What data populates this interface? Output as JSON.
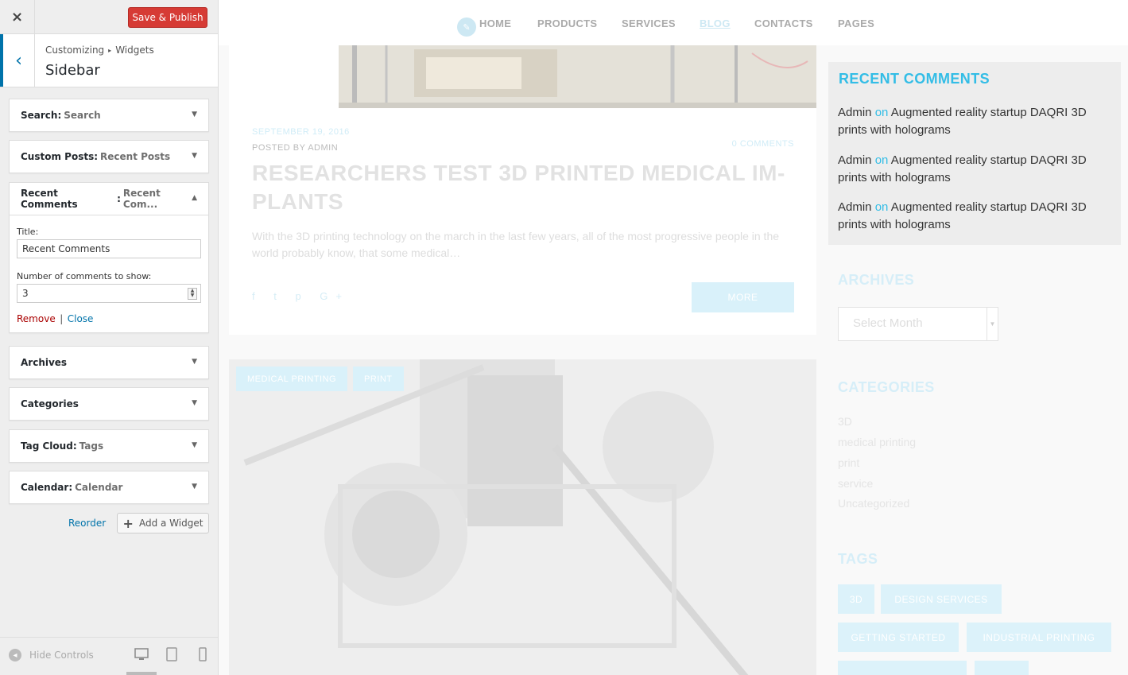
{
  "header": {
    "close_icon": "×",
    "save_label": "Save & Publish"
  },
  "section": {
    "back_icon": "‹",
    "breadcrumb_root": "Customizing",
    "breadcrumb_sep": "▸",
    "breadcrumb_current": "Widgets",
    "title": "Sidebar"
  },
  "widgets": [
    {
      "type": "Search",
      "name": "Search",
      "expanded": false
    },
    {
      "type": "Custom Posts",
      "name": "Recent Posts",
      "expanded": false
    },
    {
      "type": "Recent Comments",
      "name": "Recent Com...",
      "expanded": true
    },
    {
      "type": "Archives",
      "name": "",
      "expanded": false
    },
    {
      "type": "Categories",
      "name": "",
      "expanded": false
    },
    {
      "type": "Tag Cloud",
      "name": "Tags",
      "expanded": false
    },
    {
      "type": "Calendar",
      "name": "Calendar",
      "expanded": false
    }
  ],
  "recent_form": {
    "title_label": "Title:",
    "title_value": "Recent Comments",
    "count_label": "Number of comments to show:",
    "count_value": "3",
    "remove_label": "Remove",
    "separator": "|",
    "close_label": "Close"
  },
  "panel_actions": {
    "reorder_label": "Reorder",
    "add_widget_label": "Add a Widget"
  },
  "footer": {
    "hide_controls_label": "Hide Controls",
    "devices": [
      "desktop",
      "tablet",
      "mobile"
    ]
  },
  "site": {
    "nav": [
      "HOME",
      "PRODUCTS",
      "SERVICES",
      "BLOG",
      "CONTACTS",
      "PAGES"
    ],
    "active_nav": "BLOG",
    "post": {
      "date": "SEPTEMBER 19, 2016",
      "byline": "POSTED BY ADMIN",
      "comments": "0 COMMENTS",
      "title": "RESEARCHERS TEST 3D PRINTED MEDICAL IM-PLANTS",
      "excerpt": "With the 3D printing technology on the march in the last few years, all of the most progressive people in the world probably know, that some medical…",
      "social": "f t p G+",
      "more_label": "MORE"
    },
    "post2_tags": [
      "MEDICAL PRINTING",
      "PRINT"
    ],
    "recent_comments": {
      "title": "RECENT COMMENTS",
      "items": [
        {
          "author": "Admin",
          "on": "on",
          "post": "Augmented reality startup DAQRI 3D prints with holograms"
        },
        {
          "author": "Admin",
          "on": "on",
          "post": "Augmented reality startup DAQRI 3D prints with holograms"
        },
        {
          "author": "Admin",
          "on": "on",
          "post": "Augmented reality startup DAQRI 3D prints with holograms"
        }
      ]
    },
    "archives": {
      "title": "ARCHIVES",
      "select_placeholder": "Select Month"
    },
    "categories": {
      "title": "CATEGORIES",
      "items": [
        "3D",
        "medical printing",
        "print",
        "service",
        "Uncategorized"
      ]
    },
    "tags": {
      "title": "TAGS",
      "items": [
        "3D",
        "DESIGN SERVICES",
        "GETTING STARTED",
        "INDUSTRIAL PRINTING"
      ]
    }
  },
  "colors": {
    "accent": "#0073aa",
    "save": "#d63b35",
    "site_accent": "#33bde6",
    "remove": "#aa0000"
  }
}
